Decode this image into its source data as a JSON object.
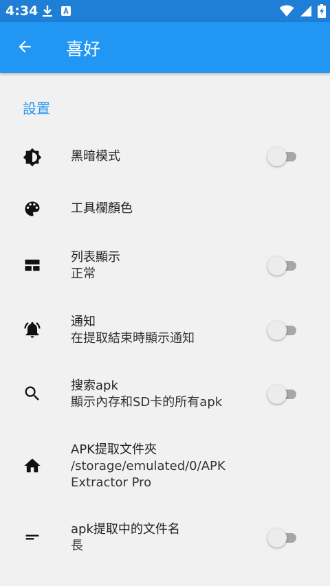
{
  "status_bar": {
    "time": "4:34",
    "icons": [
      "download-icon",
      "app-notification-icon",
      "wifi-icon",
      "signal-icon",
      "battery-charging-icon"
    ]
  },
  "app_bar": {
    "title": "喜好",
    "back_icon": "arrow-left-icon"
  },
  "section": {
    "title": "設置"
  },
  "preferences": [
    {
      "icon": "dark-mode-icon",
      "title": "黑暗模式",
      "summary": "",
      "toggle": false
    },
    {
      "icon": "palette-icon",
      "title": "工具欄顏色",
      "summary": ""
    },
    {
      "icon": "view-list-icon",
      "title": "列表顯示",
      "summary": "正常",
      "toggle": false
    },
    {
      "icon": "bell-icon",
      "title": "通知",
      "summary": "在提取結束時顯示通知",
      "toggle": false
    },
    {
      "icon": "search-icon",
      "title": "搜索apk",
      "summary": "顯示內存和SD卡的所有apk",
      "toggle": false
    },
    {
      "icon": "home-icon",
      "title": "APK提取文件夾",
      "summary": "/storage/emulated/0/APK Extractor Pro"
    },
    {
      "icon": "short-text-icon",
      "title": "apk提取中的文件名",
      "summary": "長",
      "toggle": false
    }
  ],
  "colors": {
    "status_bar": "#1f7fd6",
    "app_bar": "#2196f3",
    "accent": "#2196f3",
    "background": "#f1f1f1"
  }
}
